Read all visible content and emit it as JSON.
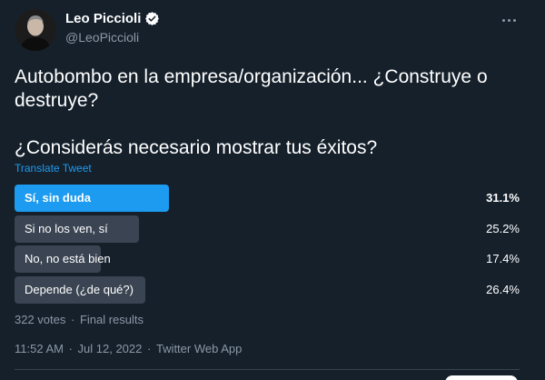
{
  "author": {
    "display_name": "Leo Piccioli",
    "handle": "@LeoPiccioli",
    "verified": true
  },
  "tweet": {
    "text_line1": "Autobombo en la empresa/organización... ¿Construye o destruye?",
    "text_line2": "¿Considerás necesario mostrar tus éxitos?",
    "translate_label": "Translate Tweet"
  },
  "poll": {
    "options": [
      {
        "label": "Sí, sin duda",
        "percent_text": "31.1%",
        "percent": 31.1,
        "leading": true
      },
      {
        "label": "Si no los ven, sí",
        "percent_text": "25.2%",
        "percent": 25.2,
        "leading": false
      },
      {
        "label": "No, no está bien",
        "percent_text": "17.4%",
        "percent": 17.4,
        "leading": false
      },
      {
        "label": "Depende (¿de qué?)",
        "percent_text": "26.4%",
        "percent": 26.4,
        "leading": false
      }
    ],
    "votes": "322 votes",
    "status": "Final results"
  },
  "meta": {
    "time": "11:52 AM",
    "date": "Jul 12, 2022",
    "source": "Twitter Web App"
  },
  "colors": {
    "background": "#15202b",
    "accent": "#1d9bf0",
    "bar": "#3a4452",
    "secondary_text": "#8b98a5"
  },
  "icons": {
    "verified": "verified-badge-icon",
    "more": "more-horizontal-icon"
  }
}
